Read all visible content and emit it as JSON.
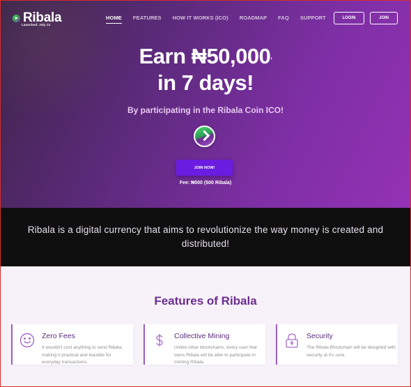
{
  "brand": {
    "name": "Ribala",
    "subtitle": "Launched: July 13"
  },
  "nav": {
    "items": [
      {
        "label": "HOME"
      },
      {
        "label": "FEATURES"
      },
      {
        "label": "HOW IT WORKS (ICO)"
      },
      {
        "label": "ROADMAP"
      },
      {
        "label": "FAQ"
      },
      {
        "label": "SUPPORT"
      }
    ],
    "login_label": "LOGIN",
    "join_label": "JOIN"
  },
  "hero": {
    "headline_line1": "Earn ₦50,000",
    "headline_mark": ",",
    "headline_line2": "in 7 days!",
    "subline": "By participating in the Ribala Coin ICO!",
    "cta_label": "JOIN NOW!",
    "fee": "Fee: ₦500 (500 Ribala)"
  },
  "band": {
    "text": "Ribala is a digital currency that aims to revolutionize the way money is created and distributed!"
  },
  "features": {
    "title": "Features of Ribala",
    "cards": [
      {
        "title": "Zero Fees",
        "icon": "smiley-icon",
        "text": "It wouldn't cost anything to send Ribala, making it practical and feasible for everyday transactions."
      },
      {
        "title": "Collective Mining",
        "icon": "dollar-icon",
        "text": "Unlike other blockchains, every user that owns Ribala will be able to participate in minting Ribala."
      },
      {
        "title": "Security",
        "icon": "lock-icon",
        "text": "The Ribala Blockchain will be designed with security at it's core."
      }
    ]
  },
  "colors": {
    "accent": "#6a1de0",
    "brand_purple": "#6a2d8e",
    "hero_start": "#3d2548",
    "hero_end": "#9432b5"
  }
}
